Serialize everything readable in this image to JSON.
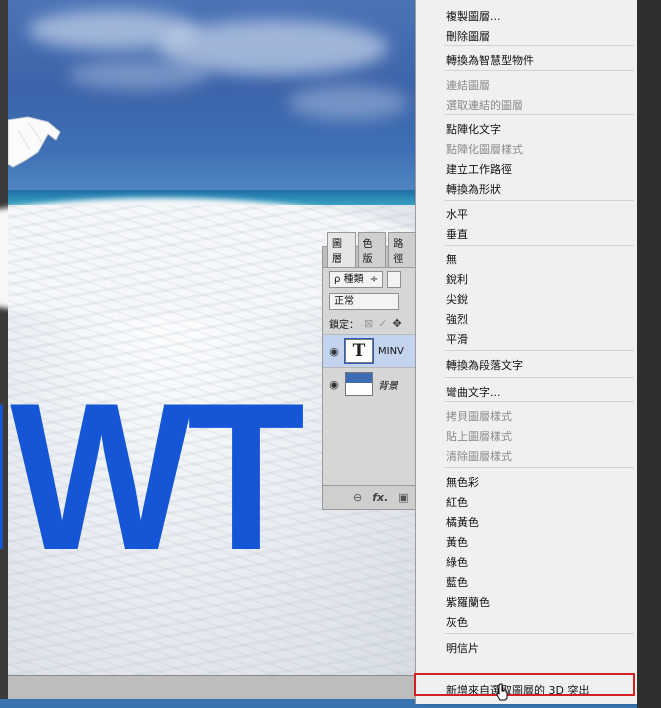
{
  "canvas_text": "IWT",
  "layers_panel": {
    "tabs": [
      "圖層",
      "色版",
      "路徑"
    ],
    "kind_select": "ρ 種類",
    "blend_mode": "正常",
    "lock_label": "鎖定：",
    "layers": [
      {
        "name": "MINV",
        "type": "text",
        "selected": true
      },
      {
        "name": "背景",
        "type": "background",
        "selected": false
      }
    ],
    "footer": [
      "⊖",
      "fx."
    ]
  },
  "context_menu": {
    "items": [
      {
        "label": "複製圖層...",
        "enabled": true
      },
      {
        "label": "刪除圖層",
        "enabled": true
      },
      {
        "label": "轉換為智慧型物件",
        "enabled": true
      },
      {
        "label": "連結圖層",
        "enabled": false
      },
      {
        "label": "選取連結的圖層",
        "enabled": false
      },
      {
        "label": "點陣化文字",
        "enabled": true
      },
      {
        "label": "點陣化圖層樣式",
        "enabled": false
      },
      {
        "label": "建立工作路徑",
        "enabled": true
      },
      {
        "label": "轉換為形狀",
        "enabled": true
      },
      {
        "label": "水平",
        "enabled": true
      },
      {
        "label": "垂直",
        "enabled": true
      },
      {
        "label": "無",
        "enabled": true
      },
      {
        "label": "銳利",
        "enabled": true
      },
      {
        "label": "尖銳",
        "enabled": true
      },
      {
        "label": "強烈",
        "enabled": true
      },
      {
        "label": "平滑",
        "enabled": true
      },
      {
        "label": "轉換為段落文字",
        "enabled": true
      },
      {
        "label": "彎曲文字...",
        "enabled": true
      },
      {
        "label": "拷貝圖層樣式",
        "enabled": false
      },
      {
        "label": "貼上圖層樣式",
        "enabled": false
      },
      {
        "label": "清除圖層樣式",
        "enabled": false
      },
      {
        "label": "無色彩",
        "enabled": true
      },
      {
        "label": "紅色",
        "enabled": true
      },
      {
        "label": "橘黃色",
        "enabled": true
      },
      {
        "label": "黃色",
        "enabled": true
      },
      {
        "label": "綠色",
        "enabled": true
      },
      {
        "label": "藍色",
        "enabled": true
      },
      {
        "label": "紫羅蘭色",
        "enabled": true
      },
      {
        "label": "灰色",
        "enabled": true
      },
      {
        "label": "明信片",
        "enabled": true
      },
      {
        "label": "新增來自選取圖層的 3D 突出",
        "enabled": true,
        "highlighted": true
      }
    ]
  },
  "colors": {
    "text_blue": "#1456d6",
    "highlight_border": "#d21f26",
    "menu_bg": "#f0f0f0"
  }
}
